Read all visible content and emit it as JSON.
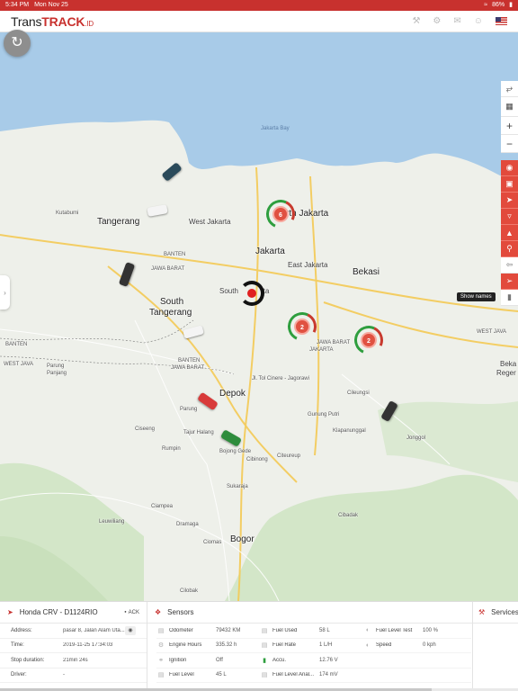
{
  "status_bar": {
    "time": "5:34 PM",
    "date": "Mon Nov 25",
    "battery": "86%"
  },
  "header": {
    "brand_prefix": "Trans",
    "brand_main": "TRACK",
    "brand_suffix": ".ID"
  },
  "map": {
    "water_labels": {
      "bay": "Jakarta Bay"
    },
    "cities": {
      "jakarta": "Jakarta",
      "north_jakarta": "rth Jakarta",
      "west_jakarta": "West Jakarta",
      "east_jakarta": "East Jakarta",
      "south_jakarta_a": "South",
      "south_jakarta_b": "rta",
      "tangerang": "Tangerang",
      "south_tangerang_a": "South",
      "south_tangerang_b": "Tangerang",
      "bekasi": "Bekasi",
      "depok": "Depok",
      "bogor": "Bogor",
      "bekasi_regency_a": "Beka",
      "bekasi_regency_b": "Reger"
    },
    "places": {
      "kutabumi": "Kutabumi",
      "banten1": "BANTEN",
      "jawa_barat1": "JAWA BARAT",
      "west_java_left": "WEST JAVA",
      "banten_left": "BANTEN",
      "parung_panjang_a": "Parung",
      "parung_panjang_b": "Panjang",
      "banten2": "BANTEN",
      "jawa_barat2": "JAWA BARAT",
      "jakarta_small": "JAKARTA",
      "jawa_barat3": "JAWA BARAT",
      "tol_cinere": "Jl. Tol Cinere - Jagorawi",
      "parung": "Parung",
      "cileungsi": "Cileungsi",
      "gunung_putri": "Gunung Putri",
      "klapanunggal": "Klapanunggal",
      "jonggol": "Jonggol",
      "ciseeng": "Ciseeng",
      "rumpin": "Rumpin",
      "tajur_halang": "Tajur Halang",
      "bojong_gede": "Bojong Gede",
      "cibinong": "Cibinong",
      "citeureup": "Citeureup",
      "sukaraja": "Sukaraja",
      "ciampea": "Ciampea",
      "leuwiliang": "Leuwiliang",
      "dramaga": "Dramaga",
      "ciomas": "Ciomas",
      "cibadak": "Cibadak",
      "cilobak": "Cilobak",
      "west_java_right": "WEST JAVA"
    },
    "clusters": [
      {
        "count": "6"
      },
      {
        "count": "2"
      },
      {
        "count": "2"
      }
    ],
    "tooltip": "Show names",
    "top_tools": [
      "expand-icon",
      "map-layers-icon",
      "zoom-in-icon",
      "zoom-out-icon"
    ],
    "red_tools": [
      "geofence-icon",
      "focus-icon",
      "navigate-icon",
      "route-icon",
      "info-icon",
      "poi-icon",
      "names-icon",
      "send-icon",
      "battery-icon"
    ],
    "zoom_in": "+",
    "zoom_out": "−"
  },
  "panel": {
    "vehicle": {
      "title": "Honda CRV - D1124RIO",
      "ack": "ACK",
      "rows": [
        {
          "label": "Address:",
          "value": "pasar 8, Jalan Alam Uta..."
        },
        {
          "label": "Time:",
          "value": "2019-11-25 17:34:03"
        },
        {
          "label": "Stop duration:",
          "value": "21min 24s"
        },
        {
          "label": "Driver:",
          "value": "-"
        }
      ]
    },
    "sensors": {
      "title": "Sensors",
      "items": [
        {
          "name": "Odometer",
          "value": "79432 KM",
          "icon": "odometer-icon"
        },
        {
          "name": "Fuel Used",
          "value": "58 L",
          "icon": "fuel-icon"
        },
        {
          "name": "Fuel Level Test",
          "value": "100 %",
          "icon": "gauge-icon"
        },
        {
          "name": "Engine Hours",
          "value": "335.32 h",
          "icon": "engine-icon"
        },
        {
          "name": "Fuel Rate",
          "value": "1 L/H",
          "icon": "fuel-icon"
        },
        {
          "name": "Speed",
          "value": "0 kph",
          "icon": "speed-icon"
        },
        {
          "name": "Ignition",
          "value": "Off",
          "icon": "ignition-icon"
        },
        {
          "name": "Accu.",
          "value": "12.76 V",
          "icon": "battery-icon"
        },
        {
          "name": "",
          "value": "",
          "icon": ""
        },
        {
          "name": "Fuel Level",
          "value": "45 L",
          "icon": "fuel-icon"
        },
        {
          "name": "Fuel Level Anal...",
          "value": "174 mV",
          "icon": "fuel-icon"
        },
        {
          "name": "",
          "value": "",
          "icon": ""
        }
      ]
    },
    "services": {
      "title": "Services"
    }
  },
  "colors": {
    "brand_red": "#c8312e",
    "accent_red": "#e24a3c",
    "water": "#a8cbe8",
    "land": "#eef0ea",
    "green": "#2e9e3e"
  }
}
